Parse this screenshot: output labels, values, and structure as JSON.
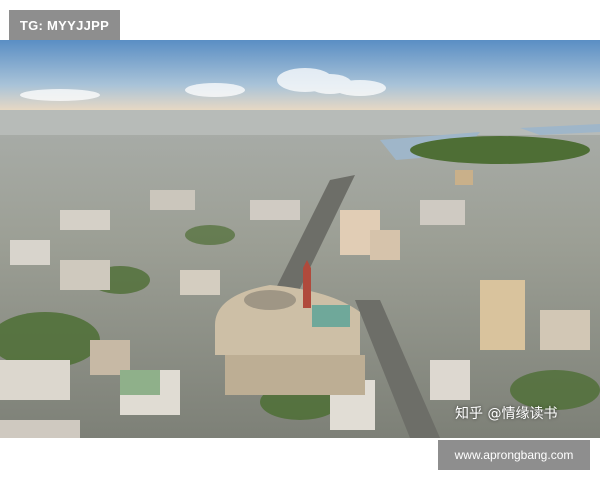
{
  "tag_badge": {
    "text": "TG: MYYJJPP"
  },
  "watermark": {
    "text": "知乎 @情缘读书"
  },
  "url_badge": {
    "text": "www.aprongbang.com"
  },
  "photo": {
    "subject": "aerial-city-panorama",
    "colors": {
      "sky_top": "#5a8ec4",
      "sky_horizon": "#f3dcc0",
      "city_base": "#8a8f86",
      "foliage": "#4e6e35",
      "river": "#9fb6c9",
      "roof_green": "#6fa89a"
    }
  }
}
